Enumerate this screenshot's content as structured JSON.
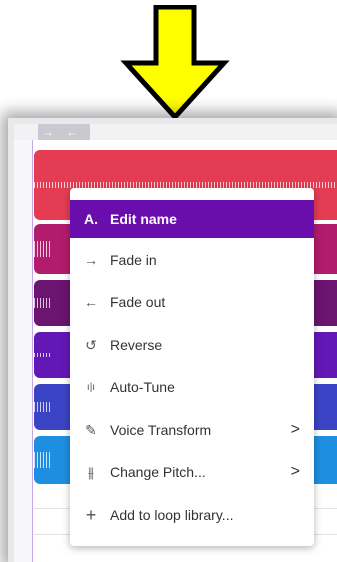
{
  "colors": {
    "arrow": "#ffff00",
    "menu_highlight": "#6a0dad",
    "tracks": [
      "#e43d53",
      "#b21c6c",
      "#6b1470",
      "#6317b5",
      "#3b44c4",
      "#1e8fe0"
    ]
  },
  "top_strip": {
    "back_arrow": "→",
    "forward_arrow": "←"
  },
  "menu": {
    "items": [
      {
        "label": "Edit name",
        "icon": "A.",
        "icon_name": "text-edit-icon",
        "active": true
      },
      {
        "label": "Fade in",
        "icon": "→",
        "icon_name": "arrow-right-icon"
      },
      {
        "label": "Fade out",
        "icon": "←",
        "icon_name": "arrow-left-icon"
      },
      {
        "label": "Reverse",
        "icon": "↺",
        "icon_name": "reverse-icon"
      },
      {
        "label": "Auto-Tune",
        "icon": "ı|ı",
        "icon_name": "autotune-icon"
      },
      {
        "label": "Voice Transform",
        "icon": "✎",
        "icon_name": "voice-transform-icon",
        "chevron": ">"
      },
      {
        "label": "Change Pitch...",
        "icon": "⫵",
        "icon_name": "pitch-sliders-icon",
        "chevron": ">"
      },
      {
        "label": "Add to loop library...",
        "icon": "+",
        "icon_name": "plus-icon"
      }
    ]
  }
}
